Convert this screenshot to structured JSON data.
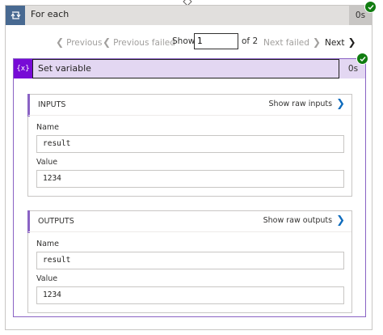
{
  "foreach": {
    "title": "For each",
    "duration": "0s",
    "icon": "loop-icon"
  },
  "pager": {
    "previous": "Previous",
    "previous_failed": "Previous failed",
    "show": "Show",
    "page_value": "1",
    "of_total": "of 2",
    "next_failed": "Next failed",
    "next": "Next"
  },
  "set_variable": {
    "title": "Set variable",
    "duration": "0s",
    "icon_text": "{x}"
  },
  "inputs": {
    "header": "INPUTS",
    "raw_link": "Show raw inputs",
    "name_label": "Name",
    "name_value": "result",
    "value_label": "Value",
    "value_value": "1234"
  },
  "outputs": {
    "header": "OUTPUTS",
    "raw_link": "Show raw outputs",
    "name_label": "Name",
    "name_value": "result",
    "value_label": "Value",
    "value_value": "1234"
  },
  "colors": {
    "foreach_accent": "#486991",
    "variable_accent": "#770bd6",
    "success": "#107c10",
    "link": "#0f6cbd"
  }
}
